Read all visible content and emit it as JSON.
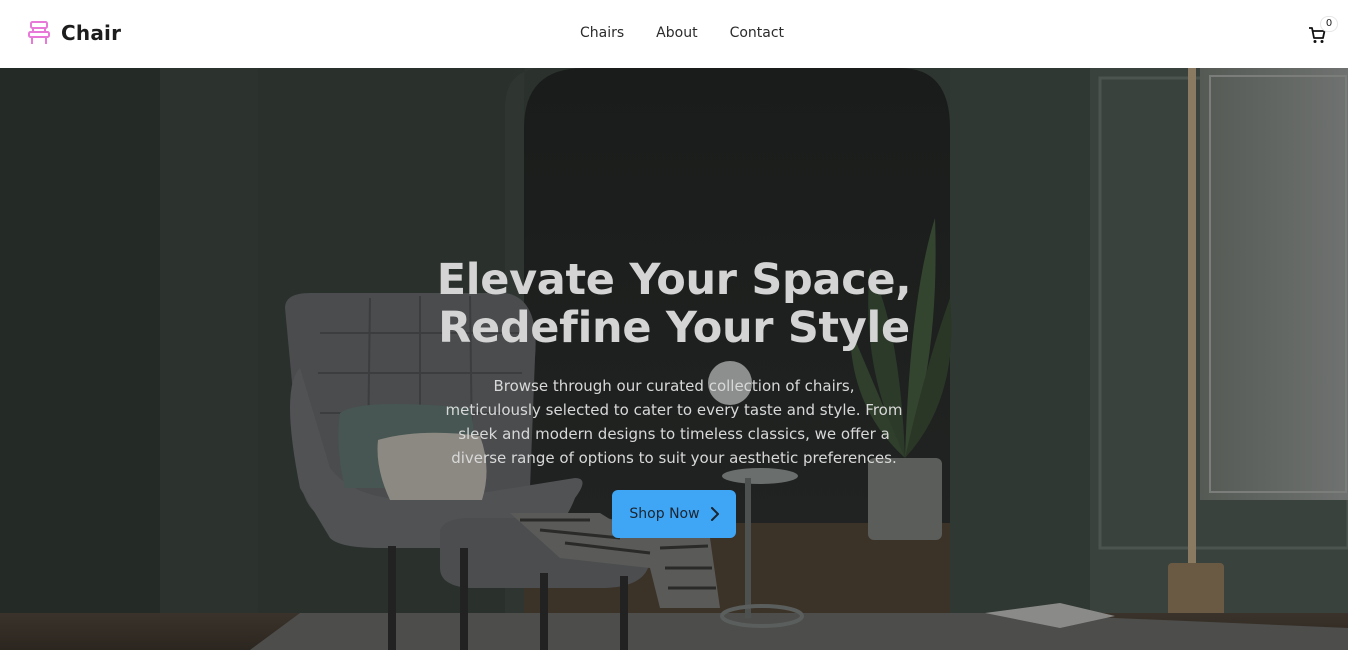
{
  "brand": {
    "name": "Chair",
    "icon": "chair-icon",
    "icon_color": "#e879d9"
  },
  "nav": {
    "items": [
      {
        "label": "Chairs"
      },
      {
        "label": "About"
      },
      {
        "label": "Contact"
      }
    ]
  },
  "cart": {
    "icon": "cart-icon",
    "count": "0"
  },
  "hero": {
    "title_line1": "Elevate Your Space,",
    "title_line2": "Redefine Your Style",
    "description": "Browse through our curated collection of chairs, meticulously selected to cater to every taste and style. From sleek and modern designs to timeless classics, we offer a diverse range of options to suit your aesthetic preferences.",
    "cta_label": "Shop Now",
    "cta_icon": "chevron-right-icon",
    "cta_color": "#3ea6f5",
    "background_image": "dark-green-living-room-with-armchair-and-plant"
  }
}
